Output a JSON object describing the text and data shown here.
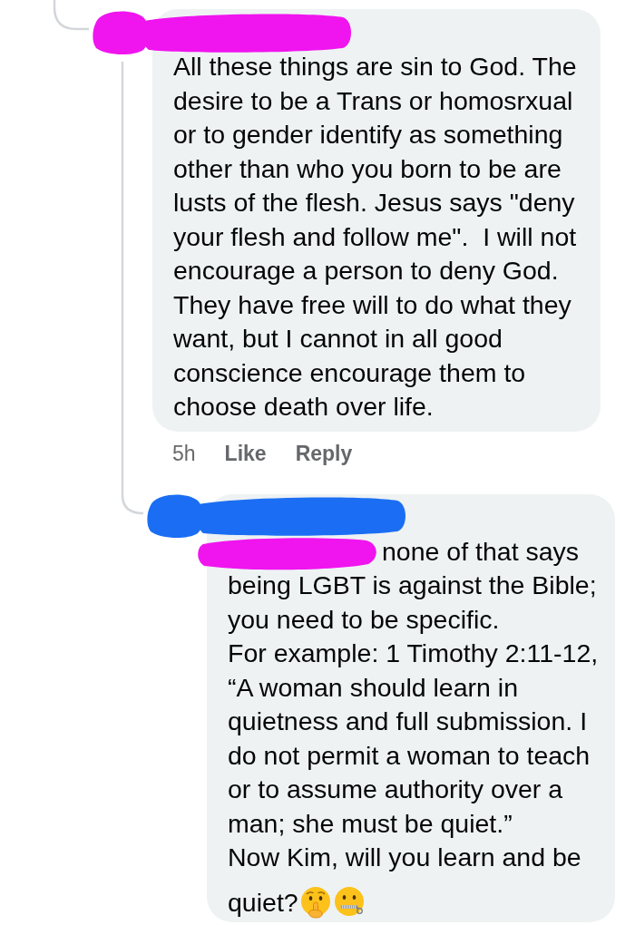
{
  "thread": {
    "comments": [
      {
        "author_redaction": {
          "color": "#f014ef"
        },
        "text": "All these things are sin to God. The desire to be a Trans or homosrxual or to gender identify as something other than who you born to be are lusts of the flesh. Jesus says \"deny your flesh and follow me\".  I will not encourage a person to deny God. They have free will to do what they want, but I cannot in all good conscience encourage them to choose death over life.",
        "time": "5h",
        "actions": [
          "Like",
          "Reply"
        ],
        "replies": [
          {
            "author_redaction": {
              "color": "#1b6ef3"
            },
            "mention_redaction": {
              "color": "#f014ef"
            },
            "text": "none of that says being LGBT is against the Bible; you need to be specific.\nFor example: 1 Timothy 2:11-12, “A woman should learn in quietness and full submission. I do not permit a woman to teach or to assume authority over a man; she must be quiet.”\nNow Kim, will you learn and be",
            "closing_line": {
              "text": "quiet?",
              "emojis": [
                {
                  "kind": "shushing-face"
                },
                {
                  "kind": "zipper-mouth-face"
                }
              ]
            }
          }
        ]
      }
    ]
  }
}
